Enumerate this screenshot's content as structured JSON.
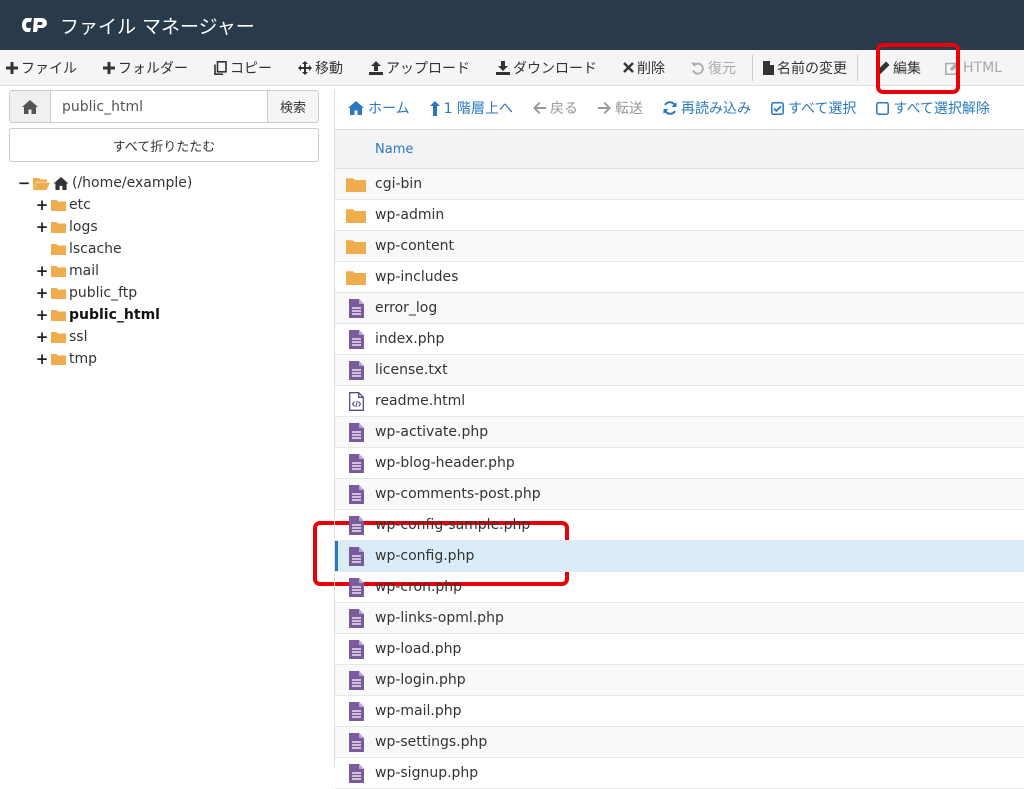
{
  "header": {
    "title": "ファイル マネージャー",
    "logo": "cp-logo"
  },
  "toolbar": {
    "buttons": [
      {
        "label": "ファイル",
        "icon": "plus-icon"
      },
      {
        "label": "フォルダー",
        "icon": "plus-icon"
      },
      {
        "label": "コピー",
        "icon": "copy-icon"
      },
      {
        "label": "移動",
        "icon": "move-icon"
      },
      {
        "label": "アップロード",
        "icon": "upload-icon"
      },
      {
        "label": "ダウンロード",
        "icon": "download-icon"
      },
      {
        "label": "削除",
        "icon": "close-icon"
      },
      {
        "label": "復元",
        "icon": "undo-icon"
      },
      {
        "label": "名前の変更",
        "icon": "file-icon"
      },
      {
        "label": "編集",
        "icon": "pencil-icon"
      },
      {
        "label": "HTML",
        "icon": "edit-icon"
      }
    ]
  },
  "left": {
    "path_value": "public_html",
    "search_label": "検索",
    "collapse_label": "すべて折りたたむ",
    "tree_root": "(/home/example)",
    "tree": [
      {
        "label": "etc",
        "expandable": true
      },
      {
        "label": "logs",
        "expandable": true
      },
      {
        "label": "lscache",
        "expandable": false
      },
      {
        "label": "mail",
        "expandable": true
      },
      {
        "label": "public_ftp",
        "expandable": true
      },
      {
        "label": "public_html",
        "expandable": true,
        "bold": true
      },
      {
        "label": "ssl",
        "expandable": true
      },
      {
        "label": "tmp",
        "expandable": true
      }
    ]
  },
  "nav": {
    "home": "ホーム",
    "up": "1 階層上へ",
    "back": "戻る",
    "forward": "転送",
    "reload": "再読み込み",
    "select_all": "すべて選択",
    "deselect_all": "すべて選択解除"
  },
  "table": {
    "column_name": "Name",
    "files": [
      {
        "name": "cgi-bin",
        "type": "folder"
      },
      {
        "name": "wp-admin",
        "type": "folder"
      },
      {
        "name": "wp-content",
        "type": "folder"
      },
      {
        "name": "wp-includes",
        "type": "folder"
      },
      {
        "name": "error_log",
        "type": "file"
      },
      {
        "name": "index.php",
        "type": "file"
      },
      {
        "name": "license.txt",
        "type": "file"
      },
      {
        "name": "readme.html",
        "type": "html"
      },
      {
        "name": "wp-activate.php",
        "type": "file"
      },
      {
        "name": "wp-blog-header.php",
        "type": "file"
      },
      {
        "name": "wp-comments-post.php",
        "type": "file"
      },
      {
        "name": "wp-config-sample.php",
        "type": "file"
      },
      {
        "name": "wp-config.php",
        "type": "file",
        "selected": true
      },
      {
        "name": "wp-cron.php",
        "type": "file"
      },
      {
        "name": "wp-links-opml.php",
        "type": "file"
      },
      {
        "name": "wp-load.php",
        "type": "file"
      },
      {
        "name": "wp-login.php",
        "type": "file"
      },
      {
        "name": "wp-mail.php",
        "type": "file"
      },
      {
        "name": "wp-settings.php",
        "type": "file"
      },
      {
        "name": "wp-signup.php",
        "type": "file"
      }
    ]
  },
  "colors": {
    "header_bg": "#293a4a",
    "link": "#2a79c0",
    "folder": "#f0ad4e",
    "file": "#7a5c9c",
    "highlight": "#e8000b"
  }
}
